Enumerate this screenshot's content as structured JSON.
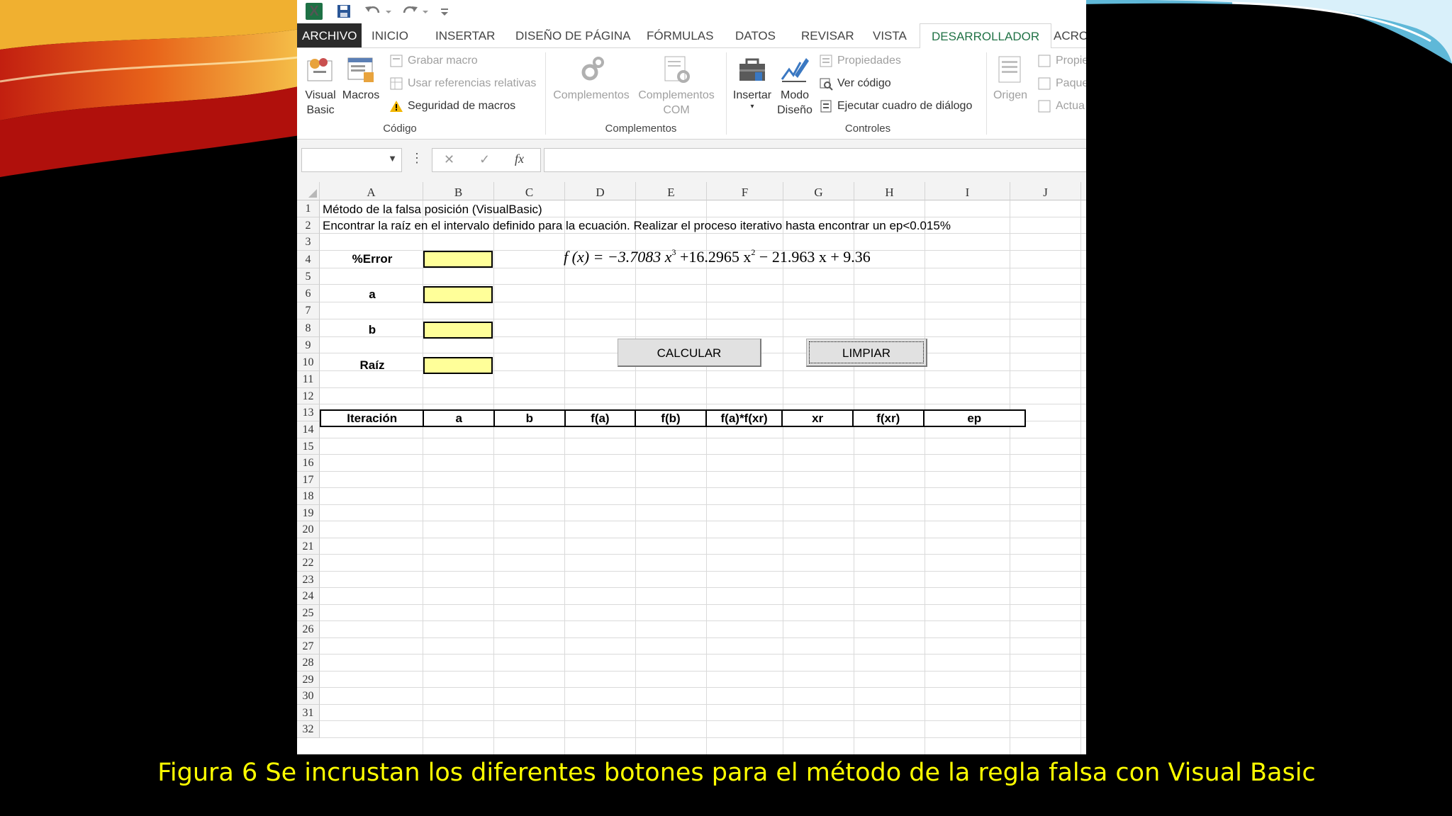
{
  "quick_access": {
    "excel_icon": "X",
    "save_icon": "save-icon",
    "undo_icon": "undo-icon",
    "redo_icon": "redo-icon",
    "customize_icon": "customize-icon"
  },
  "tabs": [
    {
      "label": "ARCHIVO"
    },
    {
      "label": "INICIO"
    },
    {
      "label": "INSERTAR"
    },
    {
      "label": "DISEÑO DE PÁGINA"
    },
    {
      "label": "FÓRMULAS"
    },
    {
      "label": "DATOS"
    },
    {
      "label": "REVISAR"
    },
    {
      "label": "VISTA"
    },
    {
      "label": "DESARROLLADOR"
    },
    {
      "label": "ACRO"
    }
  ],
  "ribbon": {
    "codigo": {
      "visual_basic": "Visual Basic",
      "macros": "Macros",
      "grabar_macro": "Grabar macro",
      "usar_referencias": "Usar referencias relativas",
      "seguridad": "Seguridad de macros",
      "group_label": "Código"
    },
    "complementos": {
      "complementos": "Complementos",
      "complementos_com_1": "Complementos",
      "complementos_com_2": "COM",
      "group_label": "Complementos"
    },
    "controles": {
      "insertar": "Insertar",
      "modo_1": "Modo",
      "modo_2": "Diseño",
      "propiedades": "Propiedades",
      "ver_codigo": "Ver código",
      "ejecutar": "Ejecutar cuadro de diálogo",
      "group_label": "Controles"
    },
    "xml": {
      "origen": "Origen",
      "propi": "Propie",
      "paque": "Paque",
      "actua": "Actua"
    }
  },
  "formula_bar": {
    "fx": "fx",
    "cancel": "✕",
    "enter": "✓",
    "more": "⋮"
  },
  "columns": [
    "A",
    "B",
    "C",
    "D",
    "E",
    "F",
    "G",
    "H",
    "I",
    "J"
  ],
  "rows": [
    "1",
    "2",
    "3",
    "4",
    "5",
    "6",
    "7",
    "8",
    "9",
    "10",
    "11",
    "12",
    "13",
    "14",
    "15",
    "16",
    "17",
    "18",
    "19",
    "20",
    "21",
    "22",
    "23",
    "24",
    "25",
    "26",
    "27",
    "28",
    "29",
    "30",
    "31",
    "32"
  ],
  "sheet": {
    "title": "Método de la falsa posición (VisualBasic)",
    "instruction": "Encontrar la raíz en el intervalo definido para la ecuación. Realizar el proceso iterativo hasta encontrar un ep<0.015%",
    "labels": {
      "error": "%Error",
      "a": "a",
      "b": "b",
      "raiz": "Raíz"
    },
    "formula": {
      "lhs": "f (x) = −3.7083 x",
      "exp1": "3",
      "mid": " +16.2965 x",
      "exp2": "2",
      "rhs": " − 21.963 x + 9.36"
    },
    "buttons": {
      "calcular": "CALCULAR",
      "limpiar": "LIMPIAR"
    },
    "table_headers": [
      "Iteración",
      "a",
      "b",
      "f(a)",
      "f(b)",
      "f(a)*f(xr)",
      "xr",
      "f(xr)",
      "ep"
    ]
  },
  "caption": "Figura 6 Se incrustan los diferentes botones para el método de la regla falsa con Visual Basic"
}
